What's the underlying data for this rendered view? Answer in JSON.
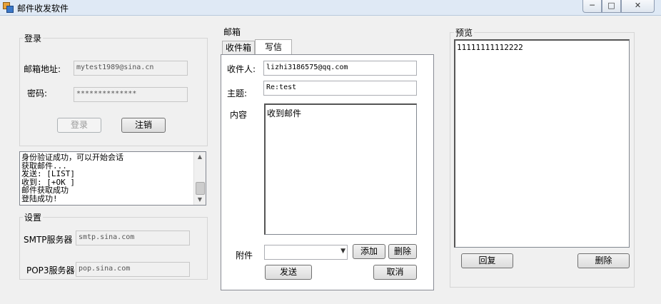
{
  "window": {
    "title": "邮件收发软件"
  },
  "login": {
    "group_title": "登录",
    "email_label": "邮箱地址:",
    "email_value": "mytest1989@sina.cn",
    "password_label": "密码:",
    "password_value": "**************",
    "login_button": "登录",
    "logout_button": "注销"
  },
  "log": {
    "lines": [
      "身份验证成功，可以开始会话",
      "获取邮件...",
      "发送: [LIST]",
      "收到: [+OK ]",
      "邮件获取成功",
      "登陆成功!"
    ]
  },
  "settings": {
    "group_title": "设置",
    "smtp_label": "SMTP服务器",
    "smtp_value": "smtp.sina.com",
    "pop3_label": "POP3服务器",
    "pop3_value": "pop.sina.com"
  },
  "mail": {
    "group_title": "邮箱",
    "tabs": [
      {
        "label": "收件箱"
      },
      {
        "label": "写信"
      }
    ],
    "active_tab": "写信",
    "recipient_label": "收件人:",
    "recipient_value": "lizhi3186575@qq.com",
    "subject_label": "主题:",
    "subject_value": "Re:test",
    "content_label": "内容",
    "content_value": "收到邮件",
    "attachment_label": "附件",
    "attachment_value": "",
    "add_button": "添加",
    "delete_button": "删除",
    "send_button": "发送",
    "cancel_button": "取消"
  },
  "preview": {
    "group_title": "预览",
    "text": "11111111112222",
    "reply_button": "回复",
    "delete_button": "删除"
  }
}
